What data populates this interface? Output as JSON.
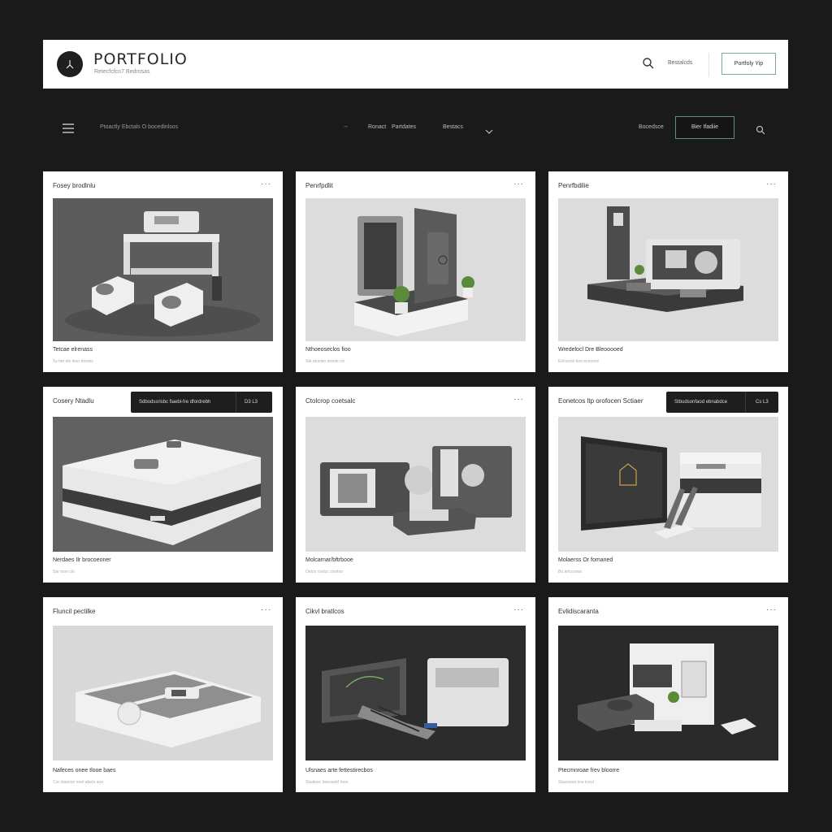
{
  "header": {
    "brand_title": "PORTFOLIO",
    "brand_subtitle": "Retecfcfco7 Bedrosas",
    "link": "Bestalcds",
    "button": "Portfoly Yip"
  },
  "nav": {
    "breadcrumb": "Ptoactly Ebctals  O bocedinlsos",
    "dash": "--",
    "item1": "Ronact",
    "item2": "Partdates",
    "item3": "Bestacs",
    "link": "Bocedsce",
    "button": "Bier Ifadiie"
  },
  "cards": [
    {
      "title": "Fosey brodlnlu",
      "caption": "Tetcae elrenass",
      "meta": "Sy bte ele leoo rbooes"
    },
    {
      "title": "Penrfpdlit",
      "caption": "Nthoeoseclos fioo",
      "meta": "Ste atocteo aroolo clo"
    },
    {
      "title": "Penrfbdilie",
      "caption": "Wredelocl Dre Bleooooed",
      "meta": "Erlcceclo boo ecaoose"
    },
    {
      "title": "Cosery Ntadlu",
      "caption": "Nerdaes Ilr brocoeoner",
      "meta": "Sar tooo clo",
      "bar_label": "Sdbodssrisbc fiaebl-fre dfordrebh",
      "bar_action": "D3    L3"
    },
    {
      "title": "Ctolcrop coetsalc",
      "caption": "Molcarnar/bftrbooe",
      "meta": "Oetco ceslcc clootoo"
    },
    {
      "title": "Eonetcos ltp orofocen Sctiaer",
      "caption": "Molaerss Or fomaned",
      "meta": "Bo arlccoooo",
      "bar_label": "Stbudsonfaod ebnabdce",
      "bar_action": "Cs    L3"
    },
    {
      "title": "Fluncil pectilke",
      "caption": "Nafeces onee tlooe baes",
      "meta": "Cor otaoosn noet abeto aoo"
    },
    {
      "title": "Cikvl bratlcos",
      "caption": "Ulsnaes arte fettestirecbos",
      "meta": "Sloaleoc beeooebf foee"
    },
    {
      "title": "Evlidiscaranta",
      "caption": "Ptecmnroae frev bloorre",
      "meta": "Sbacesoo sce trocd"
    }
  ]
}
